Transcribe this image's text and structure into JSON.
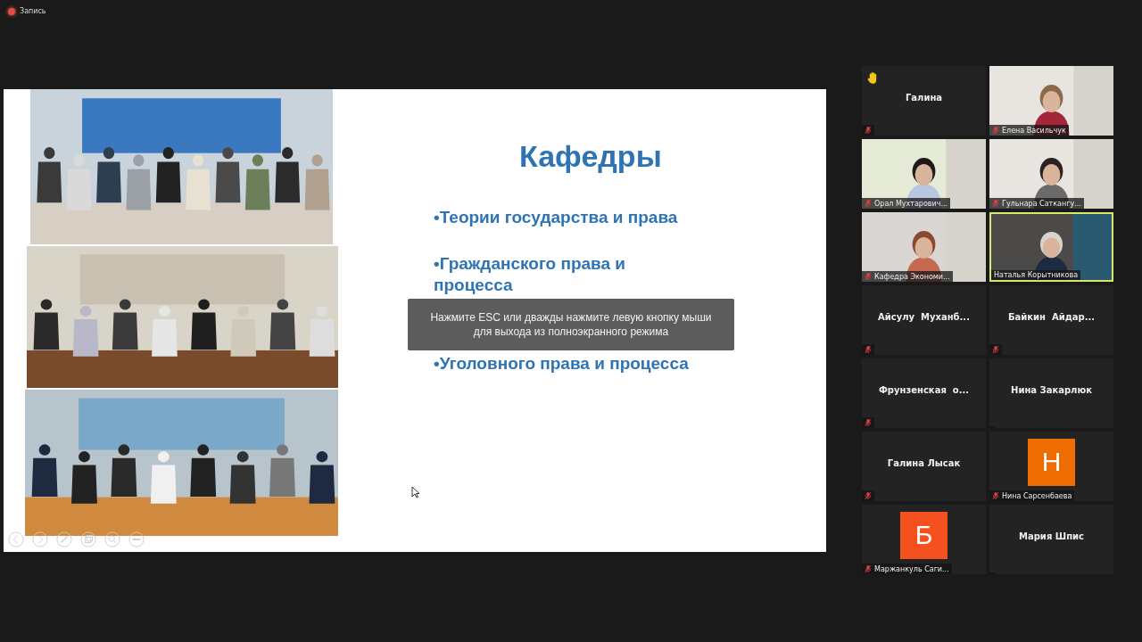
{
  "recording": {
    "label": "Запись"
  },
  "slide": {
    "title": "Кафедры",
    "bullets": [
      "•Теории государства и права",
      "•Гражданского права и процесса",
      "•Уголовного права и процесса"
    ]
  },
  "fullscreen_notice": {
    "text": "Нажмите ESC или дважды нажмите левую кнопку мыши для выхода из полноэкранного режима"
  },
  "participants": [
    {
      "kind": "name",
      "name": "Галина",
      "muted": true,
      "hand_raised": true,
      "speaking": false
    },
    {
      "kind": "video",
      "name": "Елена Васильчук",
      "muted": true,
      "hand_raised": false,
      "speaking": false
    },
    {
      "kind": "video",
      "name": "Орал Мухтарович...",
      "muted": true,
      "hand_raised": false,
      "speaking": false
    },
    {
      "kind": "video",
      "name": "Гульнара Саткангу...",
      "muted": true,
      "hand_raised": false,
      "speaking": false
    },
    {
      "kind": "video",
      "name": "Кафедра Экономи...",
      "muted": true,
      "hand_raised": false,
      "speaking": false
    },
    {
      "kind": "video",
      "name": "Наталья Корытникова",
      "muted": false,
      "hand_raised": false,
      "speaking": true
    },
    {
      "kind": "name",
      "name": "Айсулу  Муханб...",
      "muted": true,
      "hand_raised": false,
      "speaking": false
    },
    {
      "kind": "name",
      "name": "Байкин  Айдар...",
      "muted": true,
      "hand_raised": false,
      "speaking": false
    },
    {
      "kind": "name",
      "name": "Фрунзенская  о...",
      "muted": true,
      "hand_raised": false,
      "speaking": false
    },
    {
      "kind": "name",
      "name": "Нина Закарлюк",
      "muted": false,
      "hand_raised": false,
      "speaking": false
    },
    {
      "kind": "name",
      "name": "Галина Лысак",
      "muted": true,
      "hand_raised": false,
      "speaking": false
    },
    {
      "kind": "avatar",
      "name": "Нина Сарсенбаева",
      "letter": "Н",
      "color": "#ef6c00",
      "muted": true,
      "hand_raised": false,
      "speaking": false
    },
    {
      "kind": "avatar",
      "name": "Маржанкуль Саги...",
      "letter": "Б",
      "color": "#f4511e",
      "muted": true,
      "hand_raised": false,
      "speaking": false
    },
    {
      "kind": "name",
      "name": "Мария Шпис",
      "muted": false,
      "hand_raised": false,
      "speaking": false
    }
  ]
}
